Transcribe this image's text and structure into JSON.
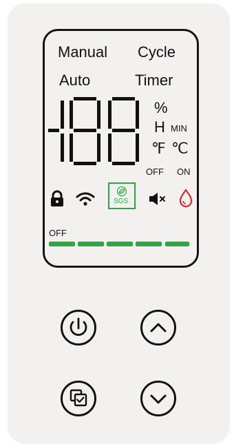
{
  "lcd": {
    "modes": {
      "manual": "Manual",
      "cycle": "Cycle",
      "auto": "Auto",
      "timer": "Timer"
    },
    "units": {
      "percent": "%",
      "hour": "H",
      "minute": "MIN",
      "fahrenheit": "℉",
      "celsius": "℃"
    },
    "mute": {
      "off": "OFF",
      "on": "ON"
    },
    "sgs_label": "SGS",
    "level_off": "OFF",
    "level_segments": 5,
    "colors": {
      "level": "#2ea742",
      "sgs": "#2ea742",
      "water": "#e0242e"
    }
  },
  "icons": [
    "lock-icon",
    "wifi-icon",
    "sgs-leaf-icon",
    "speaker-mute-icon",
    "water-drop-icon"
  ],
  "buttons": [
    "power-button",
    "up-button",
    "mode-button",
    "down-button"
  ]
}
